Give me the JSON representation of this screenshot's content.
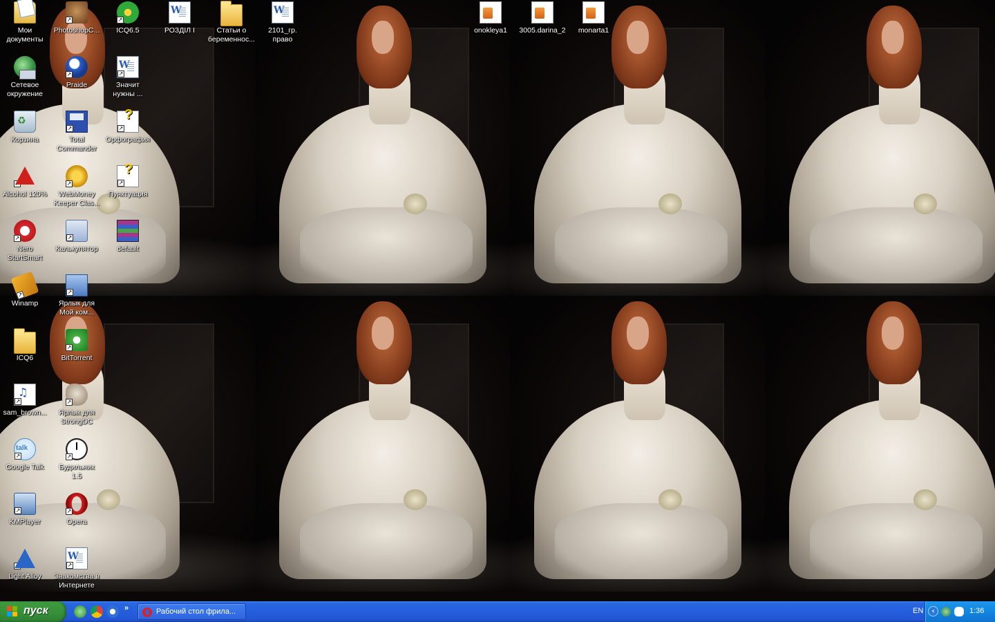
{
  "desktop": {
    "icons": [
      {
        "label": "Мои\nдокументы",
        "icon": "my-documents-icon"
      },
      {
        "label": "PhotoshopC...",
        "icon": "photoshop-icon"
      },
      {
        "label": "ICQ6.5",
        "icon": "icq-icon"
      },
      {
        "label": "РОЗДІЛ І",
        "icon": "word-document-icon"
      },
      {
        "label": "Статьи о\nбеременнос...",
        "icon": "folder-icon"
      },
      {
        "label": "2101_гр.\nправо",
        "icon": "word-document-icon"
      },
      {
        "label": "onokleya1",
        "icon": "archive-file-icon"
      },
      {
        "label": "3005.darina_2",
        "icon": "archive-file-icon"
      },
      {
        "label": "monarta1",
        "icon": "archive-file-icon"
      },
      {
        "label": "Сетевое\nокружение",
        "icon": "network-places-icon"
      },
      {
        "label": "Praide",
        "icon": "praide-icon"
      },
      {
        "label": "Значит\nнужны ...",
        "icon": "word-document-icon"
      },
      {
        "label": "Корзина",
        "icon": "recycle-bin-icon"
      },
      {
        "label": "Total\nCommander",
        "icon": "total-commander-icon"
      },
      {
        "label": "Орфография",
        "icon": "help-file-icon"
      },
      {
        "label": "Alcohol 120%",
        "icon": "alcohol-icon"
      },
      {
        "label": "WebMoney\nKeeper Clas...",
        "icon": "webmoney-icon"
      },
      {
        "label": "Пунктуация",
        "icon": "help-file-icon"
      },
      {
        "label": "Nero\nStartSmart",
        "icon": "nero-icon"
      },
      {
        "label": "Калькулятор",
        "icon": "calculator-icon"
      },
      {
        "label": "default",
        "icon": "winrar-icon"
      },
      {
        "label": "Winamp",
        "icon": "winamp-icon"
      },
      {
        "label": "Ярлык для\nМой ком...",
        "icon": "my-computer-icon"
      },
      {
        "label": "ICQ6",
        "icon": "folder-icon"
      },
      {
        "label": "BitTorrent",
        "icon": "bittorrent-icon"
      },
      {
        "label": "sam_brown...",
        "icon": "mp3-file-icon"
      },
      {
        "label": "Ярлык для\nStrongDC",
        "icon": "strongdc-icon"
      },
      {
        "label": "Google Talk",
        "icon": "google-talk-icon"
      },
      {
        "label": "Будильник\n1.5",
        "icon": "alarm-clock-icon"
      },
      {
        "label": "KMPlayer",
        "icon": "kmplayer-icon"
      },
      {
        "label": "Opera",
        "icon": "opera-icon"
      },
      {
        "label": "Light Alloy",
        "icon": "light-alloy-icon"
      },
      {
        "label": "Знакомства в\nИнтернете",
        "icon": "word-document-icon"
      }
    ]
  },
  "taskbar": {
    "start_label": "пуск",
    "quick_launch": [
      "desktop-icon",
      "chrome-icon",
      "browser-icon"
    ],
    "more_label": "»",
    "task_label": "Рабочий стол фрила...",
    "language": "EN",
    "tray_expand": "‹",
    "time": "1:36"
  },
  "colors": {
    "taskbar": "#245edc",
    "start_button": "#37913a",
    "tray": "#1286e0"
  }
}
